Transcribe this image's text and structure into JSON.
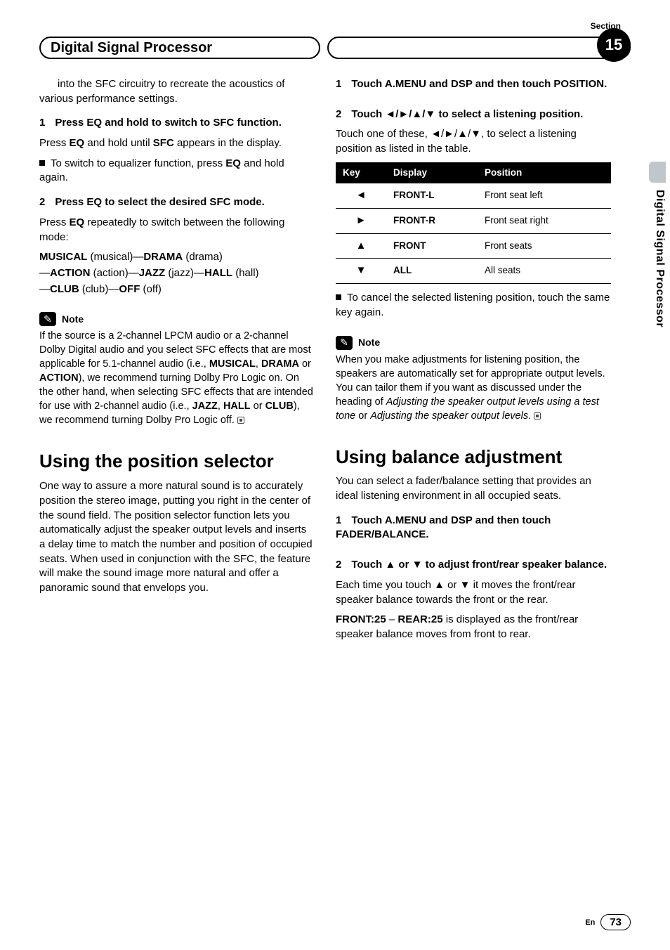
{
  "header": {
    "section_label": "Section",
    "title": "Digital Signal Processor",
    "badge": "15"
  },
  "side": {
    "text": "Digital Signal Processor"
  },
  "left": {
    "intro_cont": "into the SFC circuitry to recreate the acoustics of various performance settings.",
    "s1_head_num": "1",
    "s1_head": "Press EQ and hold to switch to SFC function.",
    "s1_p_a": "Press ",
    "s1_p_b": "EQ",
    "s1_p_c": " and hold until ",
    "s1_p_d": "SFC",
    "s1_p_e": " appears in the display.",
    "s1_bullet_a": "To switch to equalizer function, press ",
    "s1_bullet_b": "EQ",
    "s1_bullet_c": " and hold again.",
    "s2_head_num": "2",
    "s2_head": "Press EQ to select the desired SFC mode.",
    "s2_p_a": "Press ",
    "s2_p_b": "EQ",
    "s2_p_c": " repeatedly to switch between the following mode:",
    "modes_a": "MUSICAL",
    "modes_a_l": " (musical)—",
    "modes_b": "DRAMA",
    "modes_b_l": " (drama)",
    "modes_line2_pre": "—",
    "modes_c": "ACTION",
    "modes_c_l": " (action)—",
    "modes_d": "JAZZ",
    "modes_d_l": " (jazz)—",
    "modes_e": "HALL",
    "modes_e_l": " (hall)",
    "modes_line3_pre": "—",
    "modes_f": "CLUB",
    "modes_f_l": " (club)—",
    "modes_g": "OFF",
    "modes_g_l": " (off)",
    "note_label": "Note",
    "note_a": "If the source is a 2-channel LPCM audio or a 2-channel Dolby Digital audio and you select SFC effects that are most applicable for 5.1-channel audio (i.e., ",
    "note_b": "MUSICAL",
    "note_c": ", ",
    "note_d": "DRAMA",
    "note_e": " or ",
    "note_f": "ACTION",
    "note_g": "), we recommend turning Dolby Pro Logic on. On the other hand, when selecting SFC effects that are intended for use with 2-channel audio (i.e., ",
    "note_h": "JAZZ",
    "note_i": ", ",
    "note_j": "HALL",
    "note_k": " or ",
    "note_l": "CLUB",
    "note_m": "), we recommend turning Dolby Pro Logic off.",
    "h2": "Using the position selector",
    "pos_para": "One way to assure a more natural sound is to accurately position the stereo image, putting you right in the center of the sound field. The position selector function lets you automatically adjust the speaker output levels and inserts a delay time to match the number and position of occupied seats. When used in conjunction with the SFC, the feature will make the sound image more natural and offer a panoramic sound that envelops you."
  },
  "right": {
    "s1_num": "1",
    "s1_head": "Touch A.MENU and DSP and then touch POSITION.",
    "s2_num": "2",
    "s2_head": "Touch ◄/►/▲/▼ to select a listening position.",
    "s2_p": "Touch one of these, ◄/►/▲/▼, to select a listening position as listed in the table.",
    "table": {
      "h1": "Key",
      "h2": "Display",
      "h3": "Position",
      "rows": [
        {
          "k": "◄",
          "d": "FRONT-L",
          "p": "Front seat left"
        },
        {
          "k": "►",
          "d": "FRONT-R",
          "p": "Front seat right"
        },
        {
          "k": "▲",
          "d": "FRONT",
          "p": "Front seats"
        },
        {
          "k": "▼",
          "d": "ALL",
          "p": "All seats"
        }
      ]
    },
    "cancel_bullet": "To cancel the selected listening position, touch the same key again.",
    "note_label": "Note",
    "note1_a": "When you make adjustments for listening position, the speakers are automatically set for appropriate output levels. You can tailor them if you want as discussed under the heading of ",
    "note1_b": "Adjusting the speaker output levels using a test tone",
    "note1_c": " or ",
    "note1_d": "Adjusting the speaker output levels",
    "note1_e": ".",
    "h2": "Using balance adjustment",
    "bal_para": "You can select a fader/balance setting that provides an ideal listening environment in all occupied seats.",
    "b1_num": "1",
    "b1_head": "Touch A.MENU and DSP and then touch FADER/BALANCE.",
    "b2_num": "2",
    "b2_head": "Touch ▲ or ▼ to adjust front/rear speaker balance.",
    "b2_p": "Each time you touch ▲ or ▼ it moves the front/rear speaker balance towards the front or the rear.",
    "b2_range_a": "FRONT:25",
    "b2_range_b": " – ",
    "b2_range_c": "REAR:25",
    "b2_range_d": " is displayed as the front/rear speaker balance moves from front to rear."
  },
  "footer": {
    "lang": "En",
    "page": "73"
  }
}
